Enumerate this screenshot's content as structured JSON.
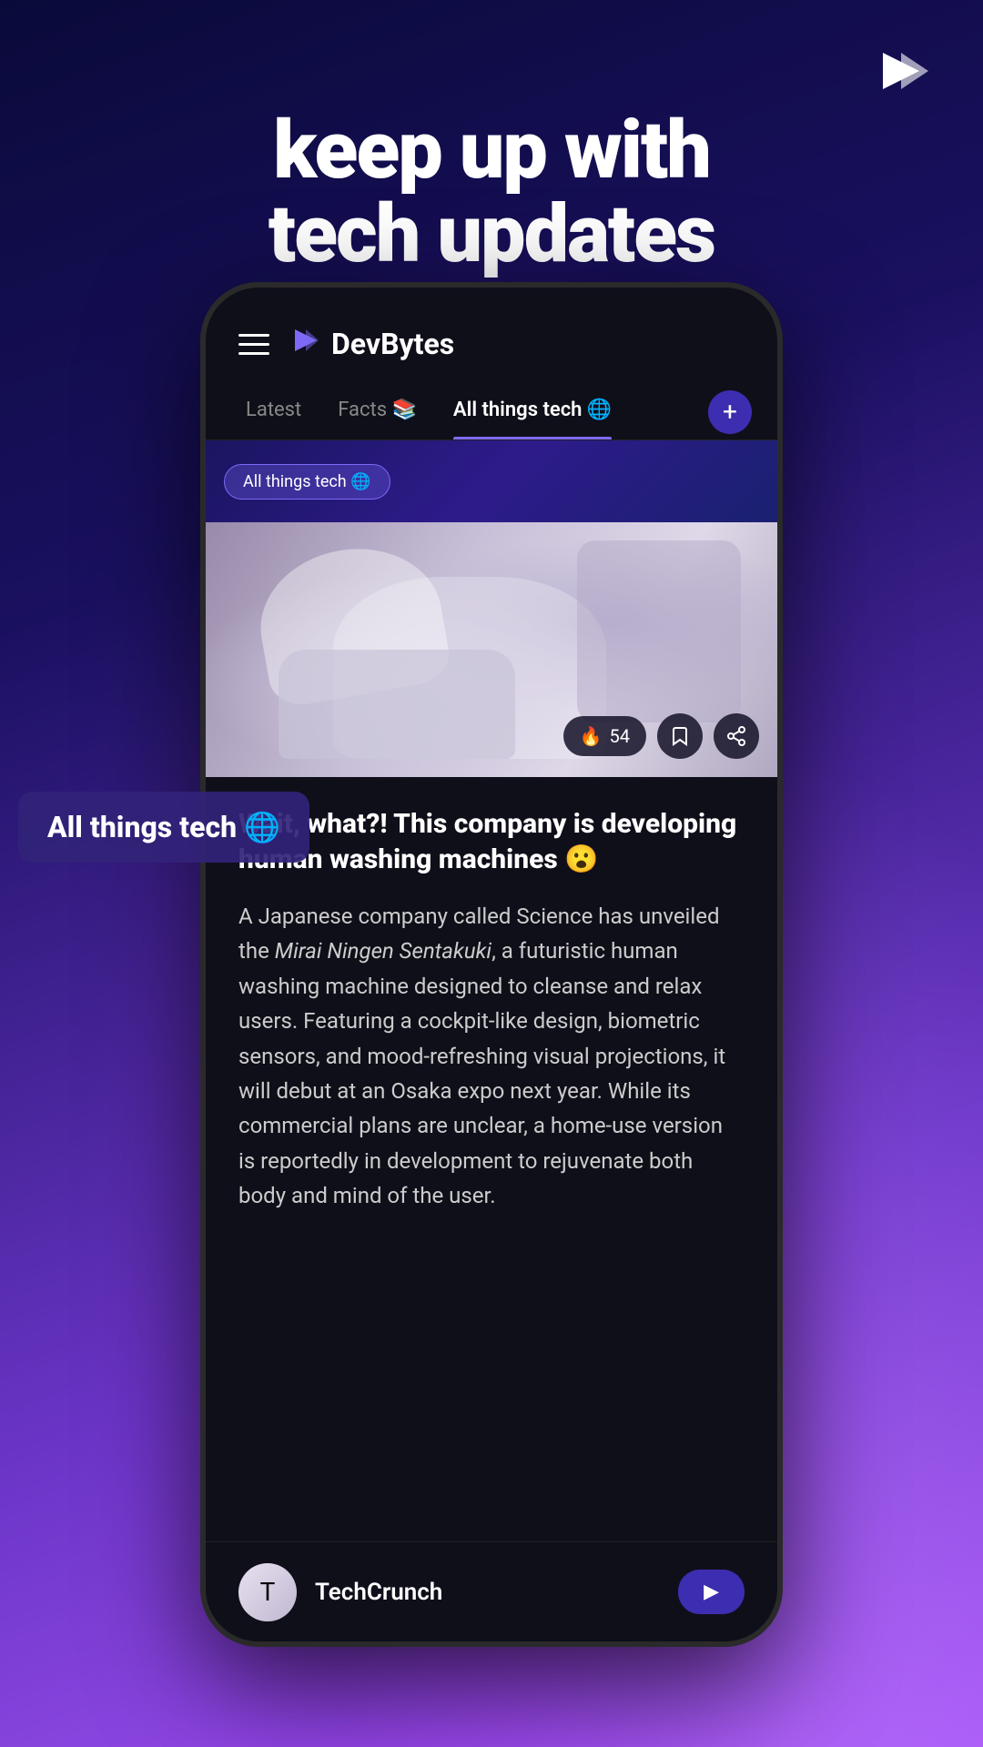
{
  "background": {
    "gradient_start": "#0a0a3a",
    "gradient_end": "#a855f7"
  },
  "logo": {
    "symbol": "▶",
    "color": "#ffffff"
  },
  "headline": {
    "line1": "keep up with",
    "line2": "tech updates"
  },
  "phone": {
    "header": {
      "app_name": "DevBytes",
      "logo_symbol": "▶",
      "logo_color": "#7c6af7"
    },
    "tabs": [
      {
        "label": "Latest",
        "active": false
      },
      {
        "label": "Facts 📚",
        "active": false
      },
      {
        "label": "All things tech 🌐",
        "active": true
      }
    ],
    "tab_add_label": "+",
    "category_label": "All things tech 🌐",
    "article": {
      "fire_count": "54",
      "title": "Wait, what?! This company is developing human washing machines 😮",
      "body_plain": "A Japanese company called Science has unveiled the ",
      "body_italic": "Mirai Ningen Sentakuki",
      "body_rest": ", a futuristic human washing machine designed to cleanse and relax users. Featuring a cockpit-like design, biometric sensors, and mood-refreshing visual projections, it will debut at an Osaka expo next year. While its commercial plans are unclear, a home-use version is reportedly in development to rejuvenate both body and mind of the user.",
      "source": "TechCrunch",
      "source_action": "▶"
    },
    "badge": {
      "text": "All things tech 🌐"
    }
  }
}
